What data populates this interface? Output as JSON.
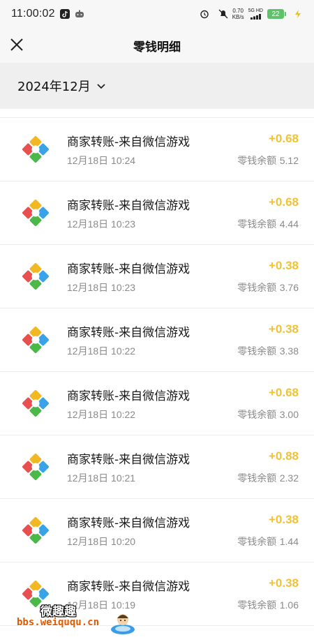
{
  "status_bar": {
    "time": "11:00:02",
    "net_speed_value": "0.70",
    "net_speed_unit": "KB/s",
    "network_type": "5G HD",
    "battery": "22"
  },
  "nav": {
    "title": "零钱明细"
  },
  "filter": {
    "month": "2024年12月"
  },
  "transactions": [
    {
      "name": "商家转账-来自微信游戏",
      "date": "12月18日 10:24",
      "amount": "+0.68",
      "balance_label": "零钱余额",
      "balance": "5.12"
    },
    {
      "name": "商家转账-来自微信游戏",
      "date": "12月18日 10:23",
      "amount": "+0.68",
      "balance_label": "零钱余额",
      "balance": "4.44"
    },
    {
      "name": "商家转账-来自微信游戏",
      "date": "12月18日 10:23",
      "amount": "+0.38",
      "balance_label": "零钱余额",
      "balance": "3.76"
    },
    {
      "name": "商家转账-来自微信游戏",
      "date": "12月18日 10:22",
      "amount": "+0.38",
      "balance_label": "零钱余额",
      "balance": "3.38"
    },
    {
      "name": "商家转账-来自微信游戏",
      "date": "12月18日 10:22",
      "amount": "+0.68",
      "balance_label": "零钱余额",
      "balance": "3.00"
    },
    {
      "name": "商家转账-来自微信游戏",
      "date": "12月18日 10:21",
      "amount": "+0.88",
      "balance_label": "零钱余额",
      "balance": "2.32"
    },
    {
      "name": "商家转账-来自微信游戏",
      "date": "12月18日 10:20",
      "amount": "+0.38",
      "balance_label": "零钱余额",
      "balance": "1.44"
    },
    {
      "name": "商家转账-来自微信游戏",
      "date": "12月18日 10:19",
      "amount": "+0.38",
      "balance_label": "零钱余额",
      "balance": "1.06"
    }
  ],
  "watermark": {
    "title": "微趣趣",
    "url": "bbs.weiququ.cn"
  },
  "colors": {
    "amount": "#f2c230",
    "secondary_text": "#8a8a8a",
    "header_bg": "#f7f7f7",
    "month_bar_bg": "#efefef"
  }
}
